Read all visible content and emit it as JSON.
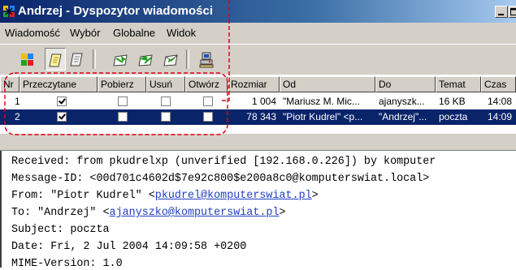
{
  "window": {
    "title": "Andrzej - Dyspozytor wiadomości"
  },
  "menu": [
    {
      "label": "Wiadomość"
    },
    {
      "label": "Wybór"
    },
    {
      "label": "Globalne"
    },
    {
      "label": "Widok"
    }
  ],
  "columns": {
    "nr": "Nr",
    "read": "Przeczytane",
    "download": "Pobierz",
    "delete": "Usuń",
    "open": "Otwórz",
    "size": "Rozmiar",
    "from": "Od",
    "to": "Do",
    "subject": "Temat",
    "time": "Czas"
  },
  "rows": [
    {
      "nr": "1",
      "read": true,
      "download": false,
      "delete": false,
      "open": false,
      "size": "1 004",
      "from": "\"Mariusz M. Mic...",
      "to": "ajanyszk...",
      "subject": "16 KB",
      "time": "14:08",
      "selected": false
    },
    {
      "nr": "2",
      "read": true,
      "download": false,
      "delete": false,
      "open": false,
      "size": "78 343",
      "from": "\"Piotr Kudrel\" <p...",
      "to": "\"Andrzej\"...",
      "subject": "poczta",
      "time": "14:09",
      "selected": true
    }
  ],
  "message": {
    "received": "Received: from pkudrelxp (unverified [192.168.0.226]) by komputer",
    "message_id": "Message-ID: <00d701c4602d$7e92c800$e200a8c0@komputerswiat.local>",
    "from_prefix": "From: \"Piotr Kudrel\" <",
    "from_email": "pkudrel@komputerswiat.pl",
    "from_suffix": ">",
    "to_prefix": "To: \"Andrzej\" <",
    "to_email": "ajanyszko@komputerswiat.pl",
    "to_suffix": ">",
    "subject": "Subject: poczta",
    "date": "Date: Fri, 2 Jul 2004 14:09:58 +0200",
    "mime": "MIME-Version: 1.0"
  },
  "colors": {
    "selection": "#0a246a",
    "annotation": "#e2001a",
    "link": "#2040c0"
  }
}
